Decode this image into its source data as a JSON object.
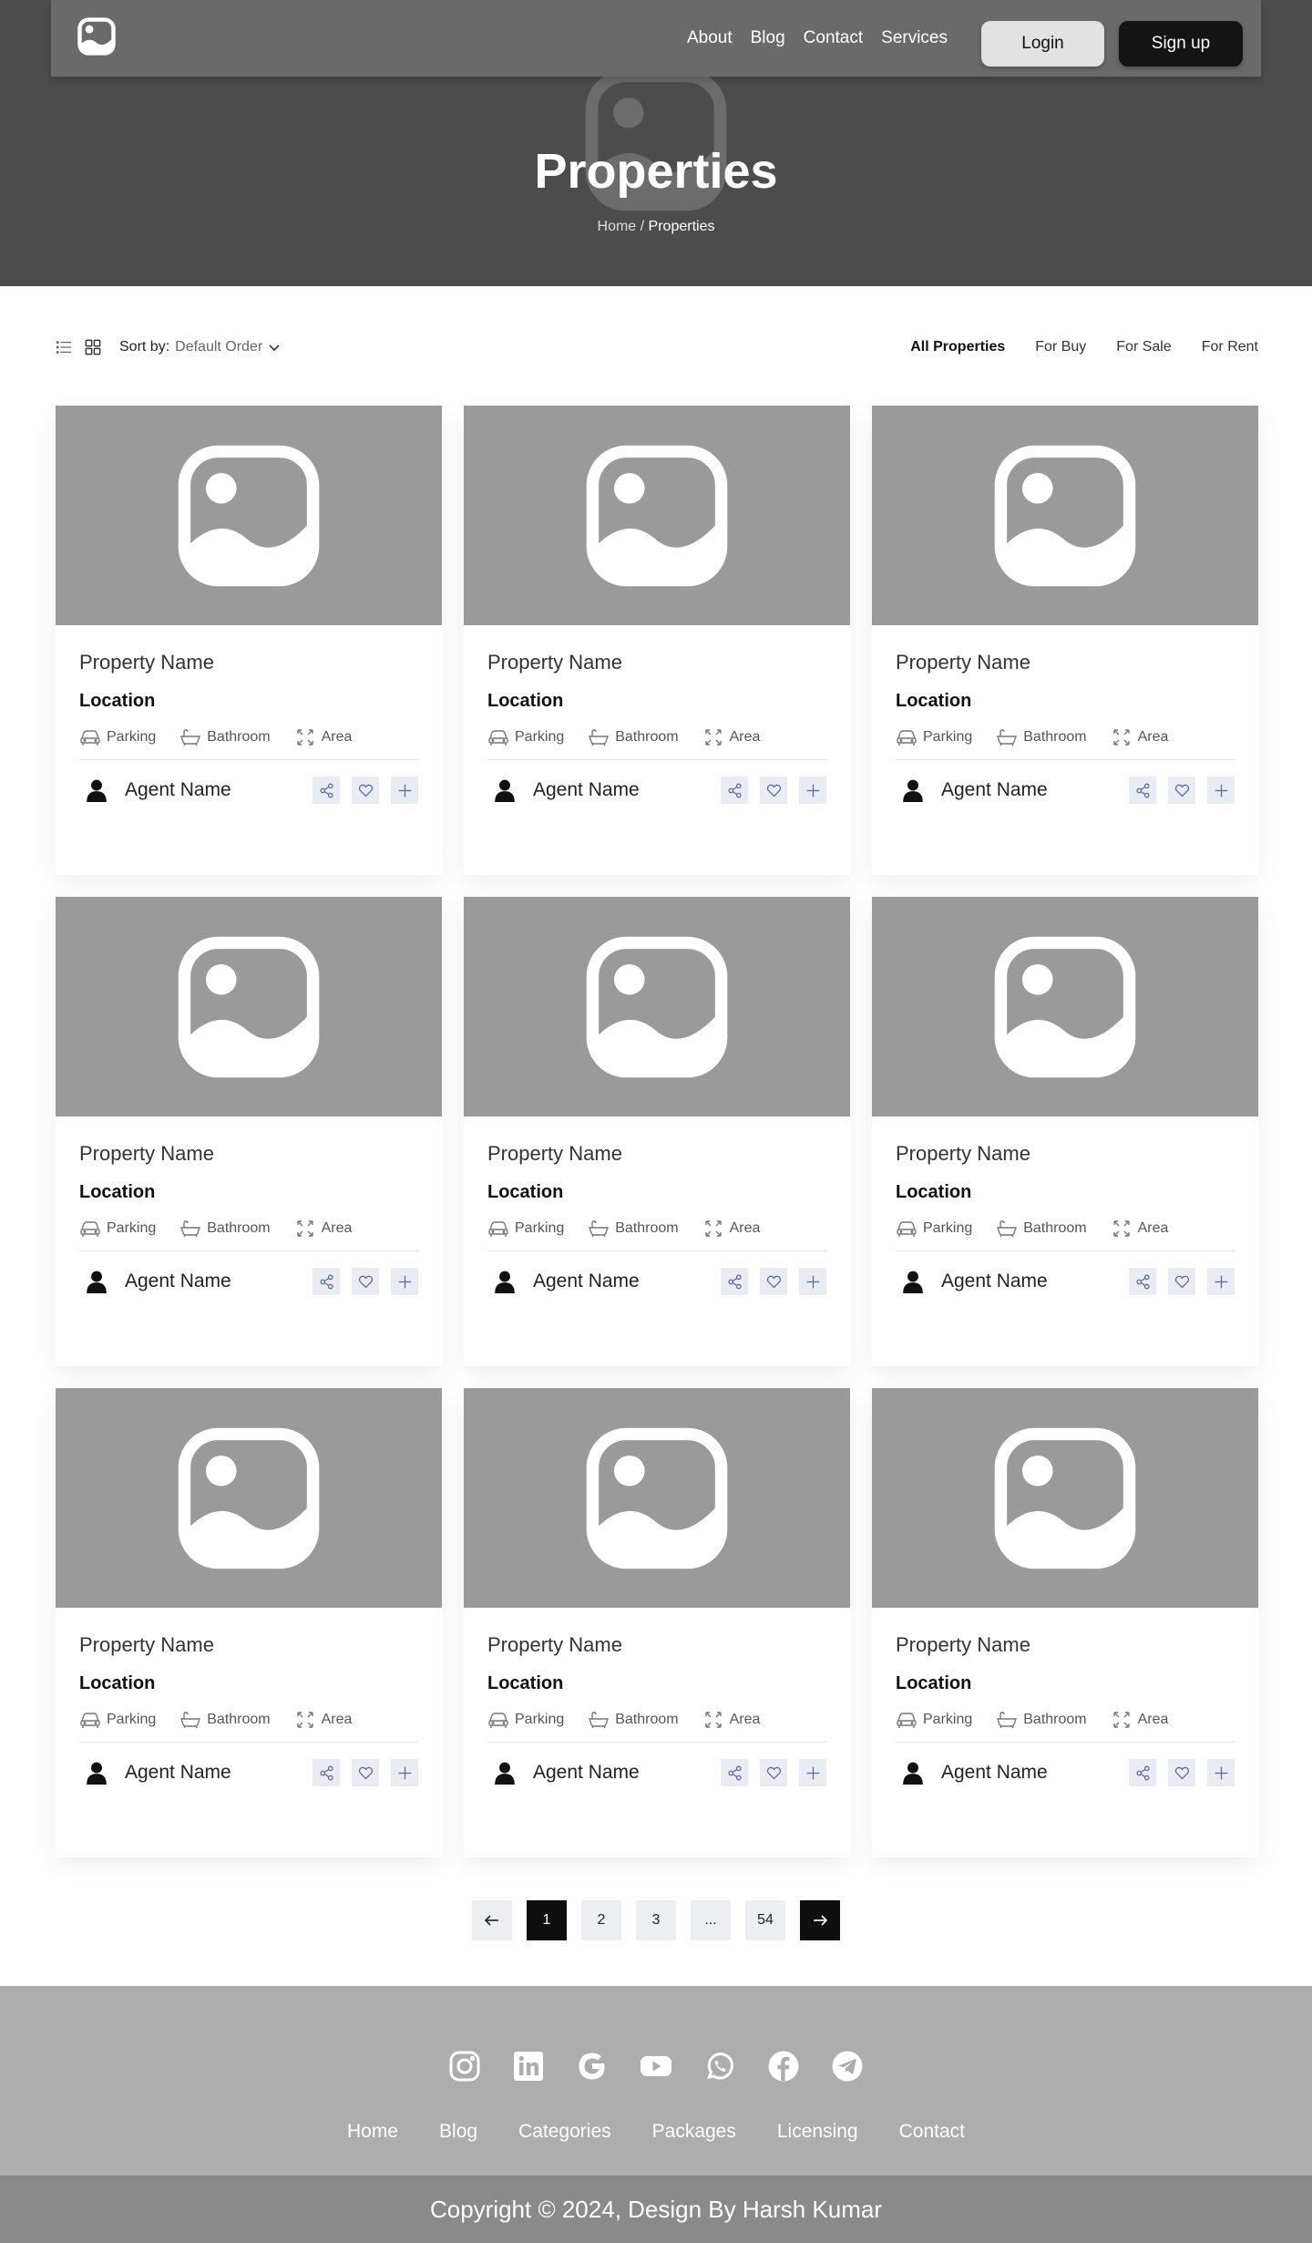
{
  "nav": {
    "links": [
      "About",
      "Blog",
      "Contact",
      "Services"
    ],
    "login_label": "Login",
    "signup_label": "Sign up"
  },
  "hero": {
    "title": "Properties",
    "breadcrumb_home": "Home",
    "breadcrumb_sep": " / ",
    "breadcrumb_current": "Properties"
  },
  "toolbar": {
    "sort_label": "Sort by:",
    "sort_value": "Default Order",
    "filters": [
      "All Properties",
      "For Buy",
      "For Sale",
      "For Rent"
    ],
    "active_filter": "All Properties"
  },
  "listings": [
    {
      "name": "Property Name",
      "location": "Location",
      "features": [
        "Parking",
        "Bathroom",
        "Area"
      ],
      "agent": "Agent Name"
    },
    {
      "name": "Property Name",
      "location": "Location",
      "features": [
        "Parking",
        "Bathroom",
        "Area"
      ],
      "agent": "Agent Name"
    },
    {
      "name": "Property Name",
      "location": "Location",
      "features": [
        "Parking",
        "Bathroom",
        "Area"
      ],
      "agent": "Agent Name"
    },
    {
      "name": "Property Name",
      "location": "Location",
      "features": [
        "Parking",
        "Bathroom",
        "Area"
      ],
      "agent": "Agent Name"
    },
    {
      "name": "Property Name",
      "location": "Location",
      "features": [
        "Parking",
        "Bathroom",
        "Area"
      ],
      "agent": "Agent Name"
    },
    {
      "name": "Property Name",
      "location": "Location",
      "features": [
        "Parking",
        "Bathroom",
        "Area"
      ],
      "agent": "Agent Name"
    },
    {
      "name": "Property Name",
      "location": "Location",
      "features": [
        "Parking",
        "Bathroom",
        "Area"
      ],
      "agent": "Agent Name"
    },
    {
      "name": "Property Name",
      "location": "Location",
      "features": [
        "Parking",
        "Bathroom",
        "Area"
      ],
      "agent": "Agent Name"
    },
    {
      "name": "Property Name",
      "location": "Location",
      "features": [
        "Parking",
        "Bathroom",
        "Area"
      ],
      "agent": "Agent Name"
    }
  ],
  "pagination": {
    "pages": [
      "1",
      "2",
      "3",
      "...",
      "54"
    ],
    "current": "1"
  },
  "footer": {
    "social_icons": [
      "instagram-icon",
      "linkedin-icon",
      "google-icon",
      "youtube-icon",
      "whatsapp-icon",
      "facebook-icon",
      "telegram-icon"
    ],
    "links": [
      "Home",
      "Blog",
      "Categories",
      "Packages",
      "Licensing",
      "Contact"
    ],
    "copyright": "Copyright © 2024, Design By Harsh Kumar"
  },
  "colors": {
    "hero_bg": "#4c4c4c",
    "navbar_bg": "#6a6a6a",
    "image_placeholder": "#9a9a9a",
    "action_bg": "#e9ecf3",
    "action_icon": "#5b6a9a",
    "footer_bg": "#adadad",
    "copyright_bg": "#8a8a8a"
  }
}
